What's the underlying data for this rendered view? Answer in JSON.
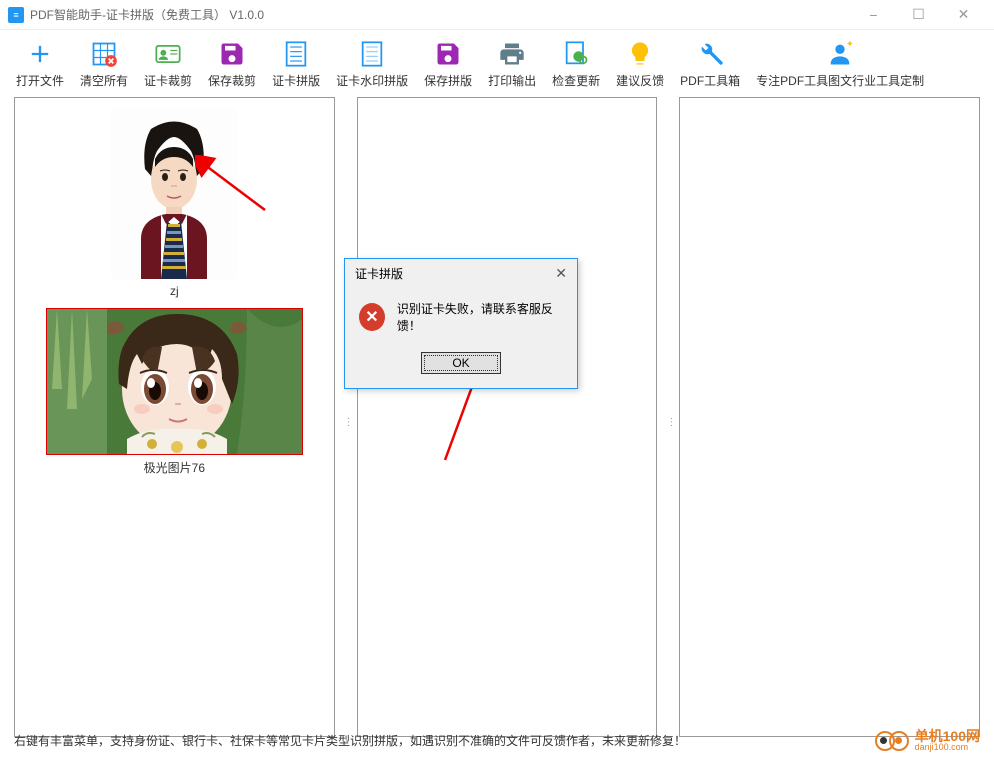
{
  "window": {
    "title": "PDF智能助手-证卡拼版（免费工具）  V1.0.0",
    "icon_text": "≡"
  },
  "window_controls": {
    "minimize": "−",
    "maximize": "☐",
    "close": "✕"
  },
  "toolbar": [
    {
      "id": "open-file",
      "label": "打开文件",
      "icon": "plus",
      "color": "#2196F3"
    },
    {
      "id": "clear-all",
      "label": "清空所有",
      "icon": "grid-x",
      "color": "#2196F3"
    },
    {
      "id": "card-crop",
      "label": "证卡裁剪",
      "icon": "id-card",
      "color": "#4CAF50"
    },
    {
      "id": "save-crop",
      "label": "保存裁剪",
      "icon": "floppy",
      "color": "#9C27B0"
    },
    {
      "id": "card-layout",
      "label": "证卡拼版",
      "icon": "sheet",
      "color": "#2196F3"
    },
    {
      "id": "watermark-layout",
      "label": "证卡水印拼版",
      "icon": "sheet-wm",
      "color": "#2196F3"
    },
    {
      "id": "save-layout",
      "label": "保存拼版",
      "icon": "floppy",
      "color": "#9C27B0"
    },
    {
      "id": "print",
      "label": "打印输出",
      "icon": "printer",
      "color": "#607D8B"
    },
    {
      "id": "check-update",
      "label": "检查更新",
      "icon": "refresh-doc",
      "color": "#2196F3"
    },
    {
      "id": "feedback",
      "label": "建议反馈",
      "icon": "bulb",
      "color": "#FFC107"
    },
    {
      "id": "toolbox",
      "label": "PDF工具箱",
      "icon": "tools",
      "color": "#2196F3"
    },
    {
      "id": "custom",
      "label": "专注PDF工具图文行业工具定制",
      "icon": "person",
      "color": "#2196F3"
    }
  ],
  "thumbnails": [
    {
      "id": "zj",
      "label": "zj",
      "type": "portrait",
      "selected": false
    },
    {
      "id": "aurora76",
      "label": "极光图片76",
      "type": "anime",
      "selected": true
    }
  ],
  "dialog": {
    "title": "证卡拼版",
    "message": "识别证卡失败，请联系客服反馈！",
    "ok_label": "OK"
  },
  "statusbar": {
    "text": "右键有丰富菜单，支持身份证、银行卡、社保卡等常见卡片类型识别拼版，如遇识别不准确的文件可反馈作者，未来更新修复！"
  },
  "watermark": {
    "main": "单机100网",
    "sub": "danji100.com"
  }
}
